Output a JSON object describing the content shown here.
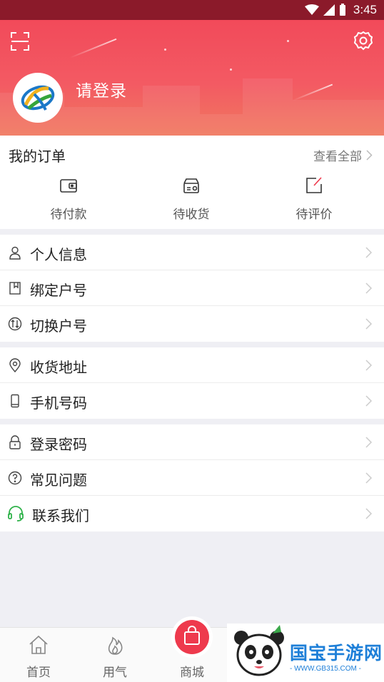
{
  "status_bar": {
    "time": "3:45"
  },
  "header": {
    "login_text": "请登录"
  },
  "orders": {
    "title": "我的订单",
    "view_all": "查看全部",
    "items": [
      {
        "label": "待付款",
        "icon": "wallet-icon"
      },
      {
        "label": "待收货",
        "icon": "delivery-box-icon"
      },
      {
        "label": "待评价",
        "icon": "edit-review-icon"
      }
    ]
  },
  "menu_groups": [
    [
      {
        "label": "个人信息",
        "icon": "person-icon"
      },
      {
        "label": "绑定户号",
        "icon": "bookmark-icon"
      },
      {
        "label": "切换户号",
        "icon": "switch-icon"
      }
    ],
    [
      {
        "label": "收货地址",
        "icon": "location-icon"
      },
      {
        "label": "手机号码",
        "icon": "phone-icon"
      }
    ],
    [
      {
        "label": "登录密码",
        "icon": "lock-icon"
      },
      {
        "label": "常见问题",
        "icon": "question-icon"
      },
      {
        "label": "联系我们",
        "icon": "headset-icon"
      }
    ]
  ],
  "tabbar": {
    "home": "首页",
    "gas": "用气",
    "mall": "商城"
  },
  "watermark": {
    "name": "国宝手游网",
    "url": "- WWW.GB315.COM -"
  },
  "colors": {
    "accent": "#ee3a4d",
    "header_top": "#f24a5a",
    "status_bar": "#8b1a2a",
    "headset_green": "#2fb24a"
  }
}
